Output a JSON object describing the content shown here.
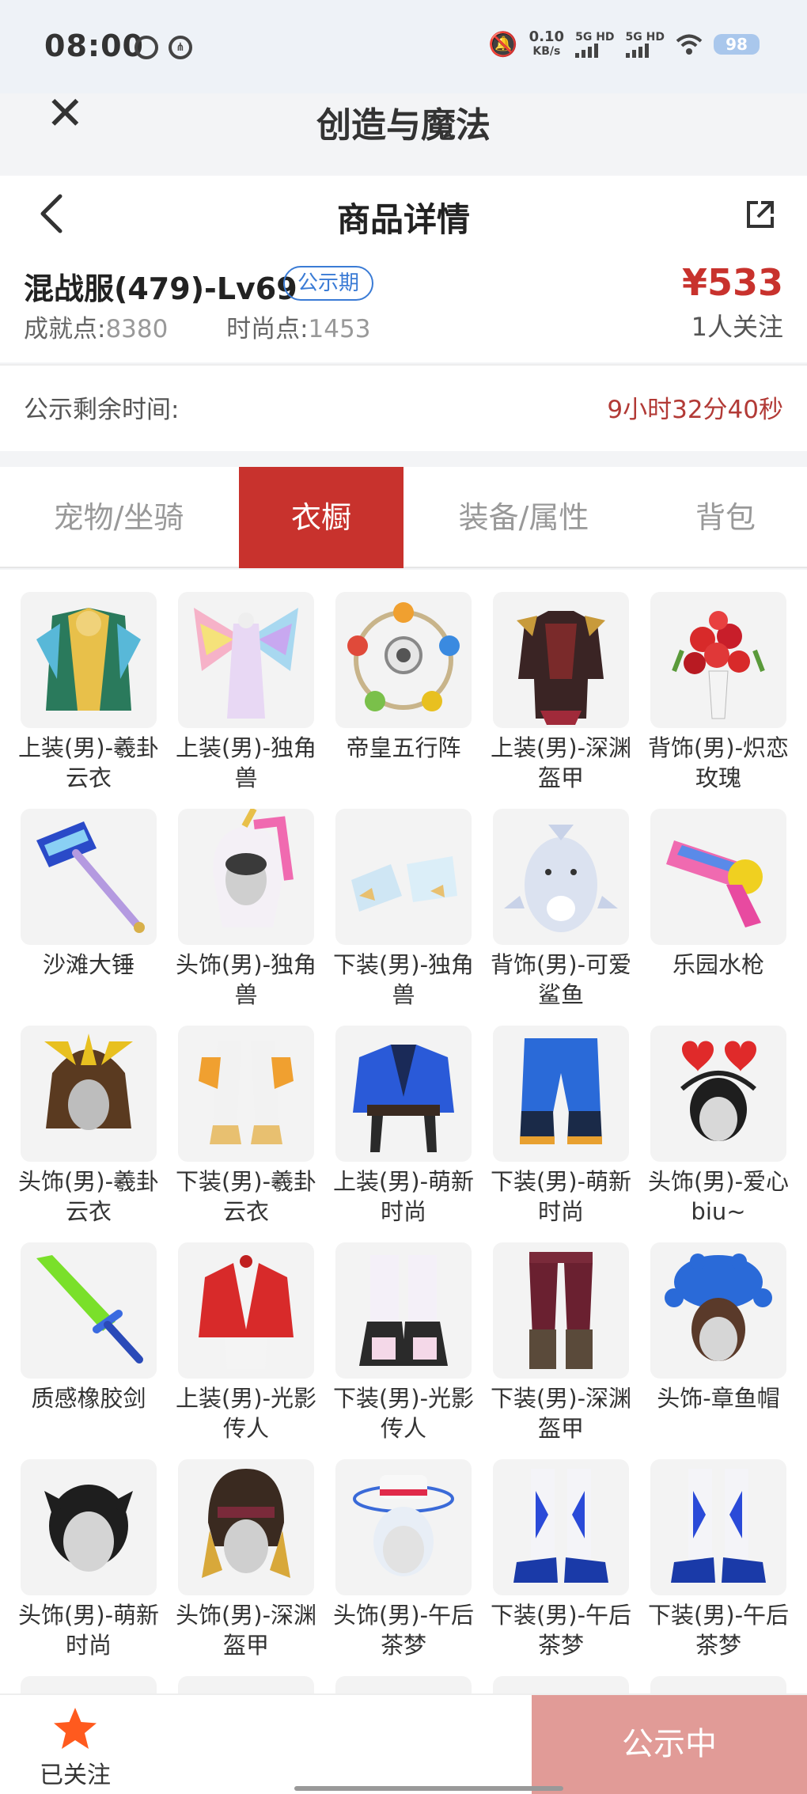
{
  "status_bar": {
    "time": "08:00",
    "net_speed": "0.10",
    "net_unit": "KB/s",
    "sim1": "5G HD",
    "sim2": "5G HD",
    "battery": "98"
  },
  "app": {
    "title": "创造与魔法"
  },
  "header": {
    "page_title": "商品详情",
    "server_name": "混战服(479)-Lv69",
    "badge": "公示期",
    "price": "¥533",
    "follow_count": "1人关注",
    "achievement_label": "成就点:",
    "achievement_value": "8380",
    "fashion_label": "时尚点:",
    "fashion_value": "1453"
  },
  "remaining": {
    "label": "公示剩余时间:",
    "value": "9小时32分40秒"
  },
  "tabs": [
    {
      "label": "宠物/坐骑"
    },
    {
      "label": "衣橱"
    },
    {
      "label": "装备/属性"
    },
    {
      "label": "背包"
    }
  ],
  "items": [
    {
      "name": "上装(男)-羲卦云衣",
      "icon": "robe-icon"
    },
    {
      "name": "上装(男)-独角兽",
      "icon": "winged-suit-icon"
    },
    {
      "name": "帝皇五行阵",
      "icon": "five-element-array-icon"
    },
    {
      "name": "上装(男)-深渊盔甲",
      "icon": "armor-icon"
    },
    {
      "name": "背饰(男)-炽恋玫瑰",
      "icon": "rose-bouquet-icon"
    },
    {
      "name": "沙滩大锤",
      "icon": "hammer-icon"
    },
    {
      "name": "头饰(男)-独角兽",
      "icon": "unicorn-hood-icon"
    },
    {
      "name": "下装(男)-独角兽",
      "icon": "boots-icon"
    },
    {
      "name": "背饰(男)-可爱鲨鱼",
      "icon": "shark-icon"
    },
    {
      "name": "乐园水枪",
      "icon": "water-gun-icon"
    },
    {
      "name": "头饰(男)-羲卦云衣",
      "icon": "headdress-icon"
    },
    {
      "name": "下装(男)-羲卦云衣",
      "icon": "pants-icon"
    },
    {
      "name": "上装(男)-萌新时尚",
      "icon": "jacket-icon"
    },
    {
      "name": "下装(男)-萌新时尚",
      "icon": "pants-icon"
    },
    {
      "name": "头饰(男)-爱心biu~",
      "icon": "heart-headband-icon"
    },
    {
      "name": "质感橡胶剑",
      "icon": "sword-icon"
    },
    {
      "name": "上装(男)-光影传人",
      "icon": "jacket-icon"
    },
    {
      "name": "下装(男)-光影传人",
      "icon": "boots-icon"
    },
    {
      "name": "下装(男)-深渊盔甲",
      "icon": "pants-icon"
    },
    {
      "name": "头饰-章鱼帽",
      "icon": "octopus-hat-icon"
    },
    {
      "name": "头饰(男)-萌新时尚",
      "icon": "hair-icon"
    },
    {
      "name": "头饰(男)-深渊盔甲",
      "icon": "helmet-icon"
    },
    {
      "name": "头饰(男)-午后茶梦",
      "icon": "sun-hat-icon"
    },
    {
      "name": "下装(男)-午后茶梦",
      "icon": "boots-icon"
    },
    {
      "name": "下装(男)-午后茶梦",
      "icon": "boots-icon"
    }
  ],
  "bottom": {
    "follow_label": "已关注",
    "status_button": "公示中"
  },
  "colors": {
    "accent": "#c8322d",
    "badge_blue": "#3a7bd5",
    "status_button_bg": "#e19b97"
  }
}
